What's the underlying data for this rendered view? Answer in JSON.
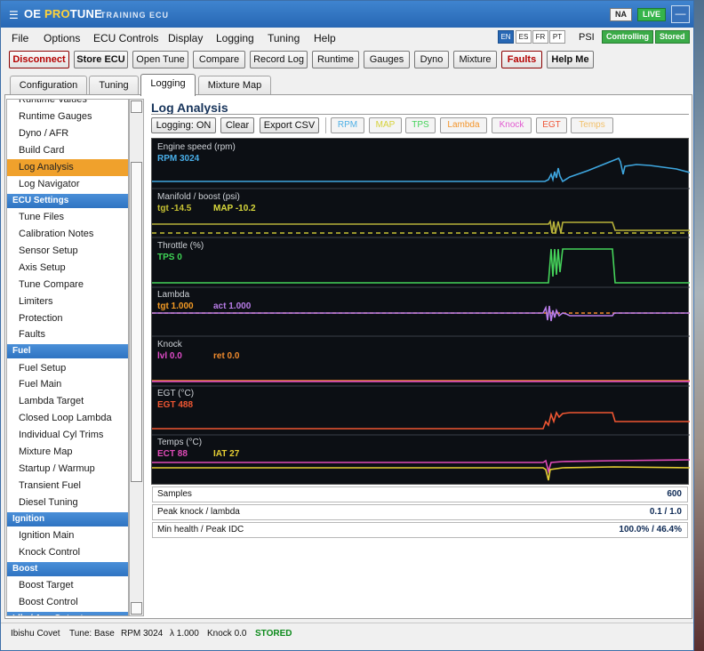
{
  "app": {
    "title_prefix": "OE ",
    "title_accent": "PRO",
    "title_suffix": "TUNE",
    "subtitle": "TRAINING ECU",
    "menu_glyph": "☰",
    "badge_na": "NA",
    "badge_live": "LIVE",
    "window_button": "—"
  },
  "menu": [
    "File",
    "Options",
    "ECU Controls",
    "Display",
    "Logging",
    "Tuning",
    "Help"
  ],
  "languages": [
    {
      "code": "EN",
      "active": true
    },
    {
      "code": "ES"
    },
    {
      "code": "FR"
    },
    {
      "code": "PT"
    }
  ],
  "unit": "PSI",
  "status_pills": [
    "Controlling",
    "Stored"
  ],
  "toolbar": [
    "Disconnect",
    "Store ECU",
    "Open Tune",
    "Compare",
    "Record Log",
    "Runtime",
    "Gauges",
    "Dyno",
    "Mixture",
    "Faults",
    "Help Me"
  ],
  "tabs": [
    "Configuration",
    "Tuning",
    "Logging",
    "Mixture Map"
  ],
  "active_tab": "Logging",
  "sidebar": [
    {
      "type": "item",
      "label": "Runtime Values"
    },
    {
      "type": "item",
      "label": "Runtime Gauges"
    },
    {
      "type": "item",
      "label": "Dyno / AFR"
    },
    {
      "type": "item",
      "label": "Build Card"
    },
    {
      "type": "item",
      "label": "Log Analysis",
      "active": true
    },
    {
      "type": "item",
      "label": "Log Navigator"
    },
    {
      "type": "header",
      "label": "ECU Settings"
    },
    {
      "type": "item",
      "label": "Tune Files"
    },
    {
      "type": "item",
      "label": "Calibration Notes"
    },
    {
      "type": "item",
      "label": "Sensor Setup"
    },
    {
      "type": "item",
      "label": "Axis Setup"
    },
    {
      "type": "item",
      "label": "Tune Compare"
    },
    {
      "type": "item",
      "label": "Limiters"
    },
    {
      "type": "item",
      "label": "Protection"
    },
    {
      "type": "item",
      "label": "Faults"
    },
    {
      "type": "header",
      "label": "Fuel"
    },
    {
      "type": "item",
      "label": "Fuel Setup"
    },
    {
      "type": "item",
      "label": "Fuel Main"
    },
    {
      "type": "item",
      "label": "Lambda Target"
    },
    {
      "type": "item",
      "label": "Closed Loop Lambda"
    },
    {
      "type": "item",
      "label": "Individual Cyl Trims"
    },
    {
      "type": "item",
      "label": "Mixture Map"
    },
    {
      "type": "item",
      "label": "Startup / Warmup"
    },
    {
      "type": "item",
      "label": "Transient Fuel"
    },
    {
      "type": "item",
      "label": "Diesel Tuning"
    },
    {
      "type": "header",
      "label": "Ignition"
    },
    {
      "type": "item",
      "label": "Ignition Main"
    },
    {
      "type": "item",
      "label": "Knock Control"
    },
    {
      "type": "header",
      "label": "Boost"
    },
    {
      "type": "item",
      "label": "Boost Target"
    },
    {
      "type": "item",
      "label": "Boost Control"
    },
    {
      "type": "header",
      "label": "Idle / Aux Outputs"
    }
  ],
  "log_analysis": {
    "title": "Log Analysis",
    "buttons": [
      "Logging: ON",
      "Clear",
      "Export CSV"
    ],
    "channels": [
      {
        "label": "RPM",
        "color": "#4fb0e6"
      },
      {
        "label": "MAP",
        "color": "#d6d23a"
      },
      {
        "label": "TPS",
        "color": "#45d35a"
      },
      {
        "label": "Lambda",
        "color": "#f3952c"
      },
      {
        "label": "Knock",
        "color": "#e25ad1"
      },
      {
        "label": "EGT",
        "color": "#ee5638"
      },
      {
        "label": "Temps",
        "color": "#f2c06a"
      }
    ],
    "panes": [
      {
        "title": "Engine speed (rpm)",
        "readouts": [
          {
            "text": "RPM 3024",
            "color": "#49aee8"
          }
        ]
      },
      {
        "title": "Manifold / boost (psi)",
        "readouts": [
          {
            "text": "tgt -14.5",
            "color": "#c7c233"
          },
          {
            "text": "MAP -10.2",
            "color": "#dada3c"
          }
        ]
      },
      {
        "title": "Throttle (%)",
        "readouts": [
          {
            "text": "TPS 0",
            "color": "#3fd455"
          }
        ]
      },
      {
        "title": "Lambda",
        "readouts": [
          {
            "text": "tgt 1.000",
            "color": "#f39a24"
          },
          {
            "text": "act 1.000",
            "color": "#b87ce8"
          }
        ]
      },
      {
        "title": "Knock",
        "readouts": [
          {
            "text": "lvl 0.0",
            "color": "#e04bc8"
          },
          {
            "text": "ret 0.0",
            "color": "#f08a2c"
          }
        ]
      },
      {
        "title": "EGT (°C)",
        "readouts": [
          {
            "text": "EGT 488",
            "color": "#ef5632"
          }
        ]
      },
      {
        "title": "Temps (°C)",
        "readouts": [
          {
            "text": "ECT 88",
            "color": "#e04bb8"
          },
          {
            "text": "IAT 27",
            "color": "#e6cf33"
          }
        ]
      }
    ],
    "stats": [
      {
        "label": "Samples",
        "value": "600"
      },
      {
        "label": "Peak knock / lambda",
        "value": "0.1 / 1.0"
      },
      {
        "label": "Min health / Peak IDC",
        "value": "100.0% / 46.4%"
      }
    ]
  },
  "statusbar": {
    "name": "Ibishu Covet",
    "tune": "Tune: Base",
    "rpm": "RPM 3024",
    "lambda": "λ 1.000",
    "knock": "Knock 0.0",
    "state": "STORED"
  }
}
